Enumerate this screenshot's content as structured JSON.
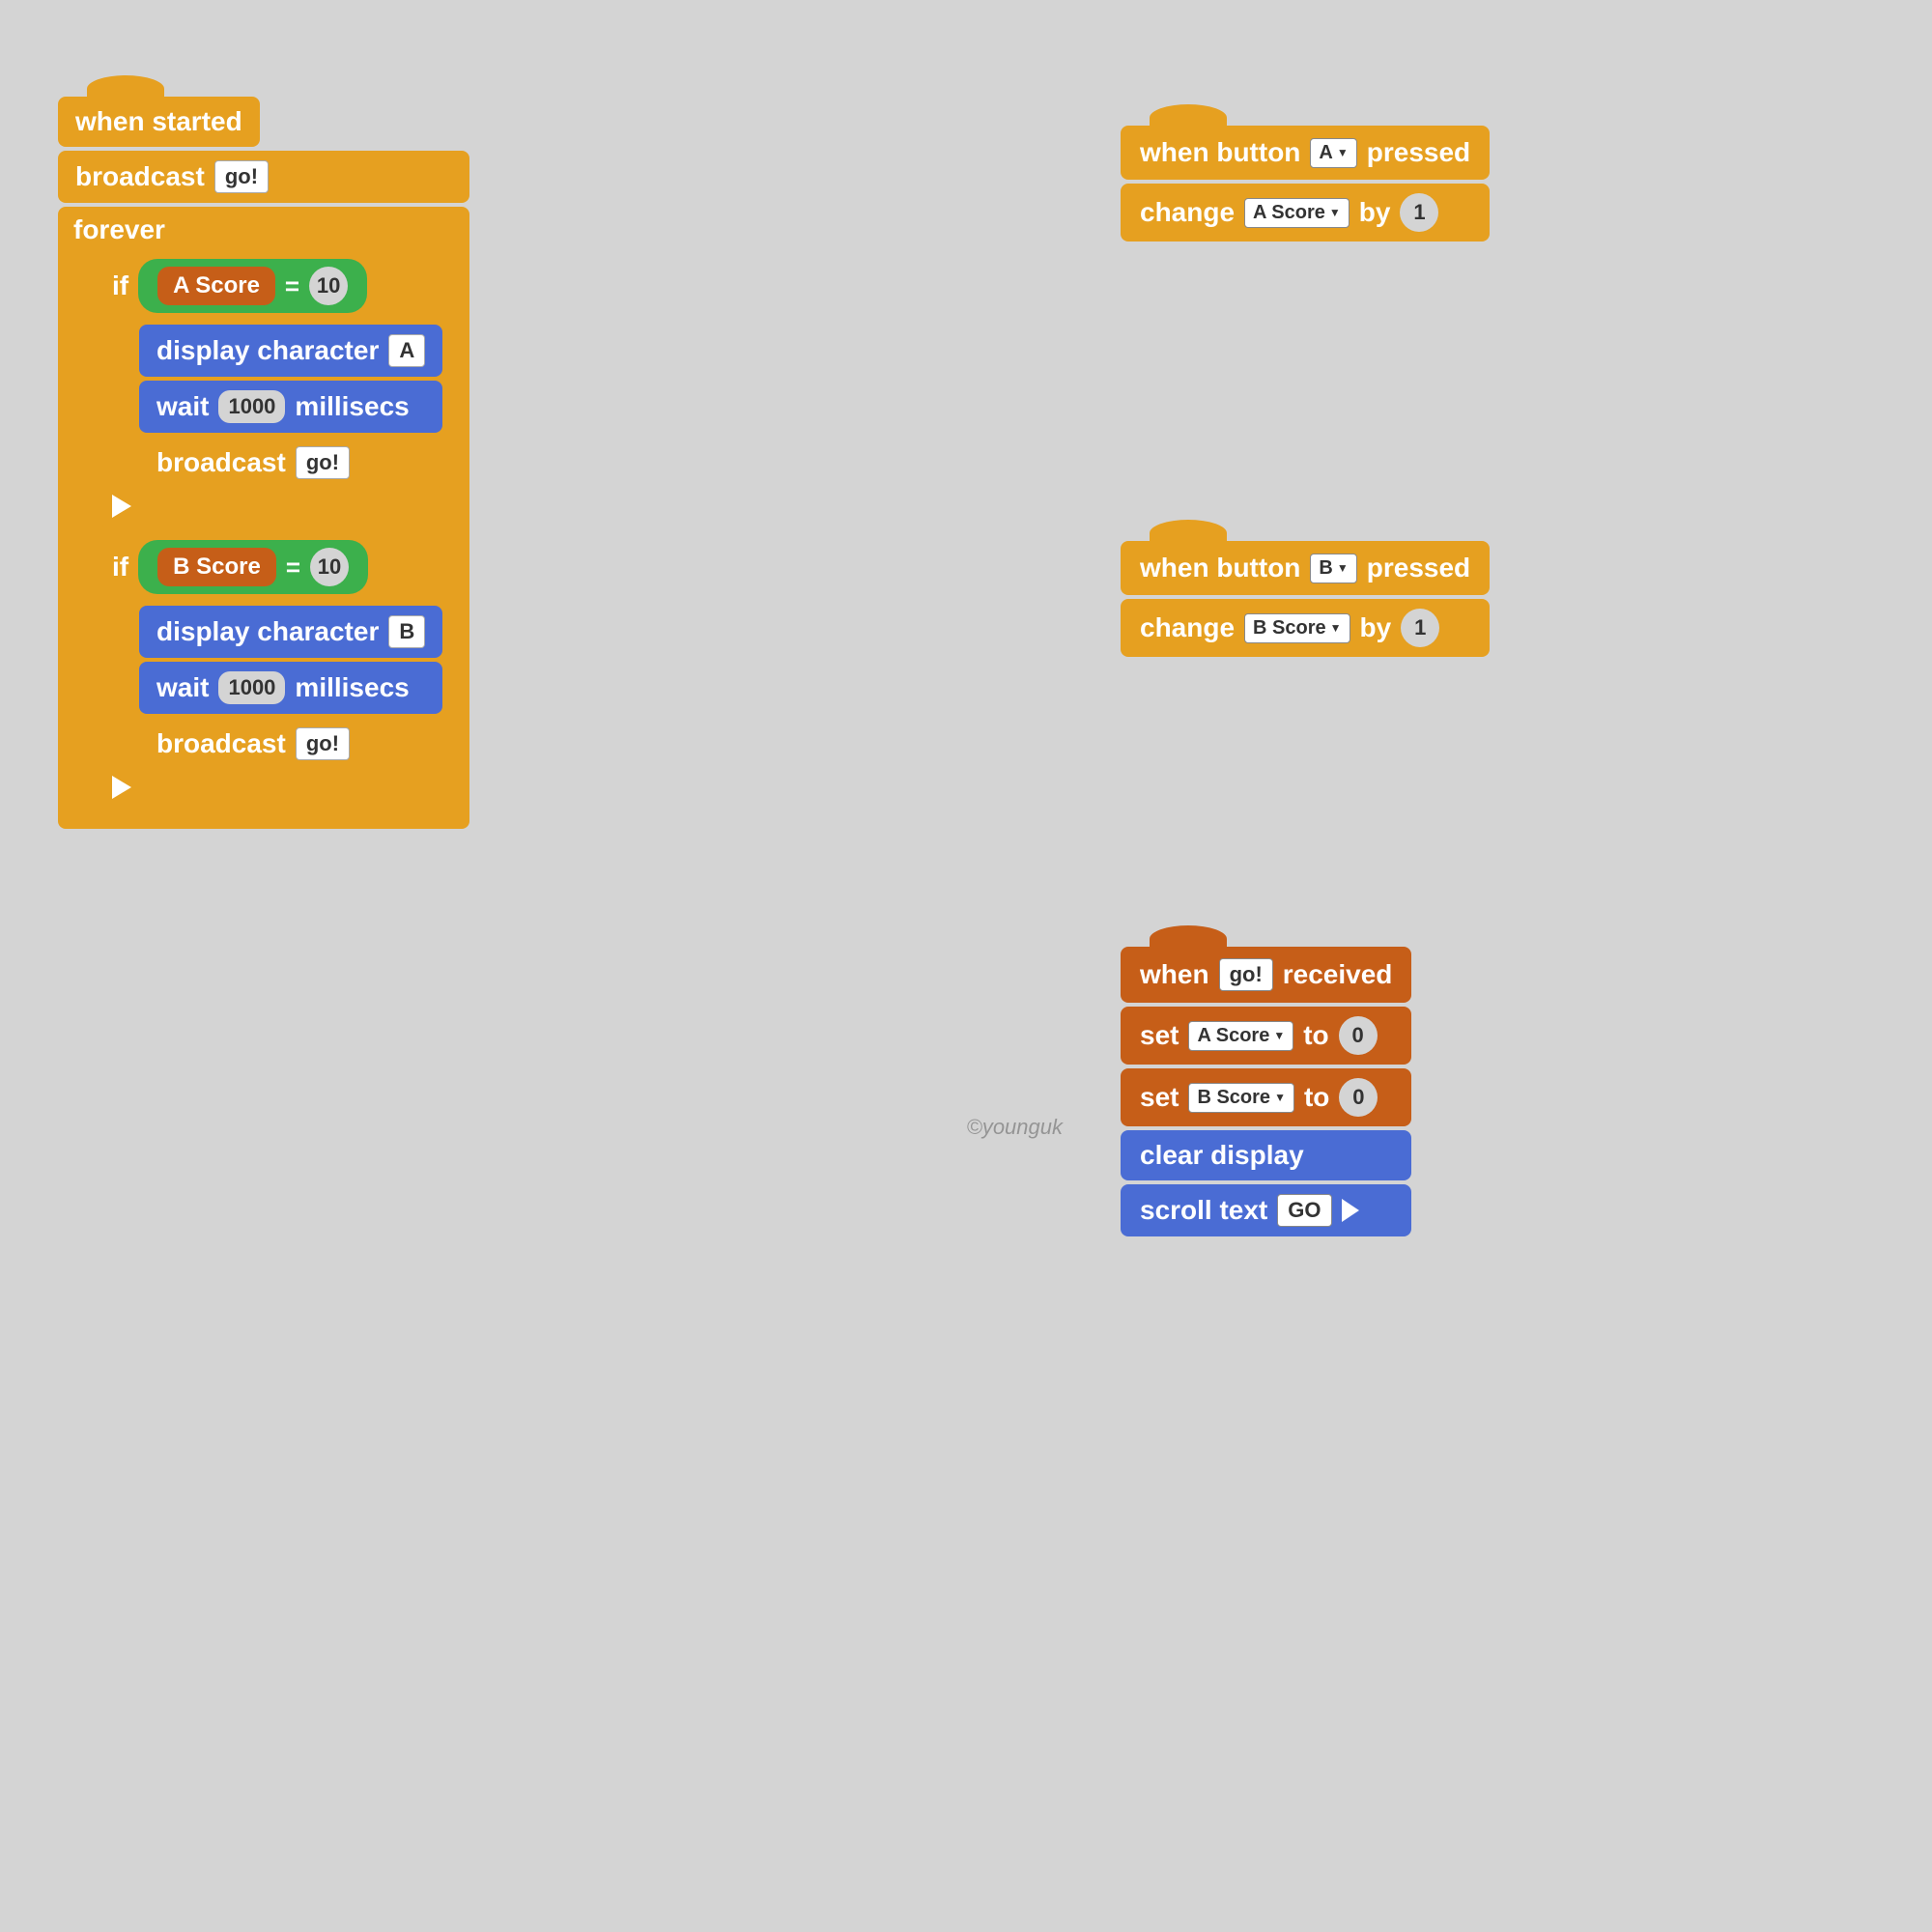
{
  "left_group": {
    "hat_label": "when started",
    "broadcast1_label": "broadcast",
    "broadcast1_value": "go!",
    "forever_label": "forever",
    "if1_label": "if",
    "if1_var": "A Score",
    "if1_eq": "=",
    "if1_val": "10",
    "display1_label": "display character",
    "display1_char": "A",
    "wait1_label": "wait",
    "wait1_val": "1000",
    "wait1_unit": "millisecs",
    "broadcast2_label": "broadcast",
    "broadcast2_value": "go!",
    "if2_label": "if",
    "if2_var": "B Score",
    "if2_eq": "=",
    "if2_val": "10",
    "display2_label": "display character",
    "display2_char": "B",
    "wait2_label": "wait",
    "wait2_val": "1000",
    "wait2_unit": "millisecs",
    "broadcast3_label": "broadcast",
    "broadcast3_value": "go!"
  },
  "top_right_group": {
    "hat_label": "when button",
    "button_val": "A",
    "pressed_label": "pressed",
    "change_label": "change",
    "change_var": "A Score",
    "by_label": "by",
    "by_val": "1"
  },
  "mid_right_group": {
    "hat_label": "when button",
    "button_val": "B",
    "pressed_label": "pressed",
    "change_label": "change",
    "change_var": "B Score",
    "by_label": "by",
    "by_val": "1"
  },
  "bottom_right_group": {
    "hat_label": "when",
    "hat_value": "go!",
    "received_label": "received",
    "set1_label": "set",
    "set1_var": "A Score",
    "set1_to": "to",
    "set1_val": "0",
    "set2_label": "set",
    "set2_var": "B Score",
    "set2_to": "to",
    "set2_val": "0",
    "clear_label": "clear display",
    "scroll_label": "scroll text",
    "scroll_val": "GO",
    "watermark": "©younguk"
  }
}
